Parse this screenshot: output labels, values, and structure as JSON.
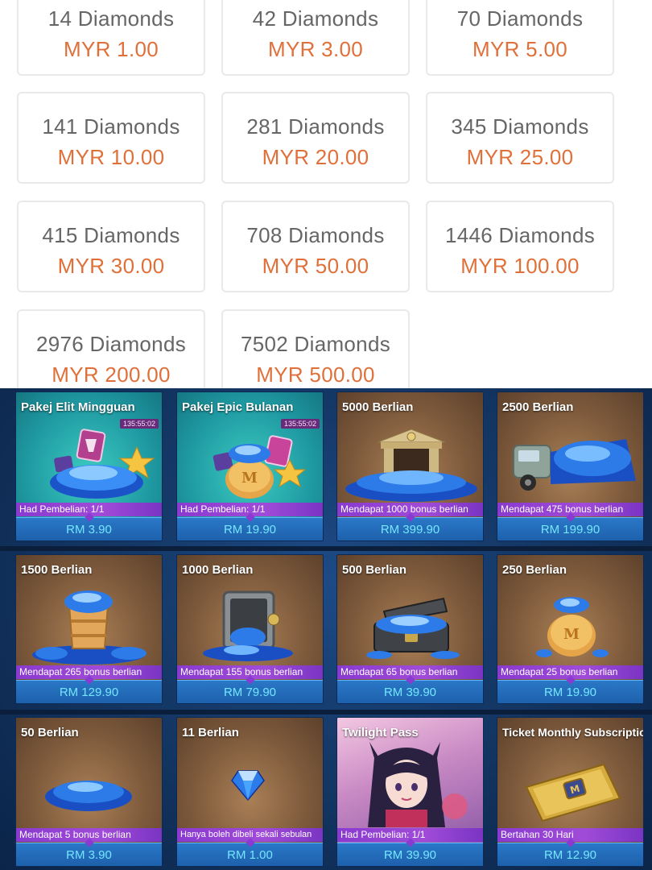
{
  "topup": {
    "items": [
      {
        "name": "14 Diamonds",
        "price": "MYR 1.00"
      },
      {
        "name": "42 Diamonds",
        "price": "MYR 3.00"
      },
      {
        "name": "70 Diamonds",
        "price": "MYR 5.00"
      },
      {
        "name": "141 Diamonds",
        "price": "MYR 10.00"
      },
      {
        "name": "281 Diamonds",
        "price": "MYR 20.00"
      },
      {
        "name": "345 Diamonds",
        "price": "MYR 25.00"
      },
      {
        "name": "415 Diamonds",
        "price": "MYR 30.00"
      },
      {
        "name": "708 Diamonds",
        "price": "MYR 50.00"
      },
      {
        "name": "1446 Diamonds",
        "price": "MYR 100.00"
      },
      {
        "name": "2976 Diamonds",
        "price": "MYR 200.00"
      },
      {
        "name": "7502 Diamonds",
        "price": "MYR 500.00"
      }
    ]
  },
  "shop": {
    "items": [
      {
        "title": "Pakej Elit Mingguan",
        "timer": "135:55:02",
        "info": "Had Pembelian: 1/1",
        "price": "RM 3.90",
        "icon": "weekly-pack-icon"
      },
      {
        "title": "Pakej Epic Bulanan",
        "timer": "135:55:02",
        "info": "Had Pembelian: 1/1",
        "price": "RM 19.90",
        "icon": "monthly-pack-icon"
      },
      {
        "title": "5000 Berlian",
        "info": "Mendapat 1000 bonus berlian",
        "price": "RM 399.90",
        "icon": "bank-diamonds-icon"
      },
      {
        "title": "2500 Berlian",
        "info": "Mendapat 475 bonus berlian",
        "price": "RM 199.90",
        "icon": "truck-diamonds-icon"
      },
      {
        "title": "1500 Berlian",
        "info": "Mendapat 265 bonus berlian",
        "price": "RM 129.90",
        "icon": "bucket-diamonds-icon"
      },
      {
        "title": "1000 Berlian",
        "info": "Mendapat 155 bonus berlian",
        "price": "RM 79.90",
        "icon": "safe-diamonds-icon"
      },
      {
        "title": "500 Berlian",
        "info": "Mendapat 65 bonus berlian",
        "price": "RM 39.90",
        "icon": "chest-diamonds-icon"
      },
      {
        "title": "250 Berlian",
        "info": "Mendapat 25 bonus berlian",
        "price": "RM 19.90",
        "icon": "bag-diamonds-icon"
      },
      {
        "title": "50 Berlian",
        "info": "Mendapat 5 bonus berlian",
        "price": "RM 3.90",
        "icon": "diamond-pile-icon"
      },
      {
        "title": "11 Berlian",
        "info": "Hanya boleh dibeli sekali sebulan",
        "price": "RM 1.00",
        "icon": "single-diamond-icon"
      },
      {
        "title": "Twilight Pass",
        "info": "Had Pembelian: 1/1",
        "price": "RM 39.90",
        "icon": "twilight-pass-icon"
      },
      {
        "title": "Ticket Monthly Subscription",
        "info": "Bertahan 30 Hari",
        "price": "RM 12.90",
        "icon": "ticket-icon"
      }
    ]
  },
  "colors": {
    "price_orange": "#e0703a",
    "name_gray": "#666666",
    "shop_price_cyan": "#74e6ff",
    "strip_purple": "#8a3ad0"
  }
}
